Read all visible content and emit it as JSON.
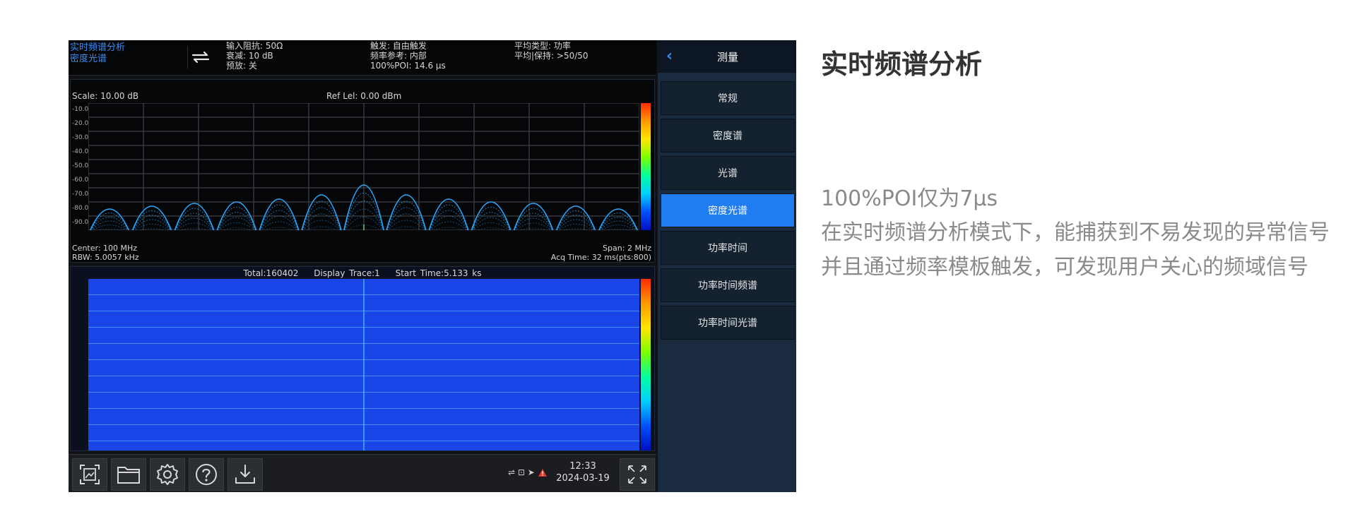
{
  "status_bar": {
    "mode_line1": "实时频谱分析",
    "mode_line2": "密度光谱",
    "col1": [
      "输入阻抗: 50Ω",
      "衰减: 10 dB",
      "预放: 关"
    ],
    "col2": [
      "触发: 自由触发",
      "频率参考: 内部",
      "100%POI: 14.6 μs"
    ],
    "col3": [
      "平均类型: 功率",
      "平均|保持: >50/50"
    ]
  },
  "spectrum": {
    "scale": "Scale: 10.00 dB",
    "ref_level": "Ref Lel: 0.00 dBm",
    "y_ticks": [
      "-10.0",
      "-20.0",
      "-30.0",
      "-40.0",
      "-50.0",
      "-60.0",
      "-70.0",
      "-80.0",
      "-90.0"
    ],
    "center": "Center: 100 MHz",
    "rbw": "RBW: 5.0057 kHz",
    "span": "Span: 2 MHz",
    "acq_time": "Acq Time: 32 ms(pts:800)",
    "lobe_peaks_db": [
      -75,
      -73,
      -71,
      -70,
      -68,
      -65,
      -58,
      -65,
      -68,
      -70,
      -71,
      -73,
      -75
    ],
    "trace_color": "#2aa8ff"
  },
  "waterfall": {
    "total": "Total:160402",
    "display_trace": "Display Trace:1",
    "start_time": "Start Time:5.133 ks",
    "fill_color": "#1a45e8"
  },
  "toolbar": {
    "status_icons": "⇌ ⊡ ➤",
    "time": "12:33",
    "date": "2024-03-19"
  },
  "menu": {
    "title": "测量",
    "items": [
      {
        "label": "常规",
        "active": false
      },
      {
        "label": "密度谱",
        "active": false
      },
      {
        "label": "光谱",
        "active": false
      },
      {
        "label": "密度光谱",
        "active": true
      },
      {
        "label": "功率时间",
        "active": false
      },
      {
        "label": "功率时间频谱",
        "active": false
      },
      {
        "label": "功率时间光谱",
        "active": false
      }
    ],
    "accent_color": "#1f7df0"
  },
  "description": {
    "title": "实时频谱分析",
    "line1": "100%POI仅为7μs",
    "line2": "在实时频谱分析模式下，能捕获到不易发现的异常信号",
    "line3": "并且通过频率模板触发，可发现用户关心的频域信号"
  }
}
